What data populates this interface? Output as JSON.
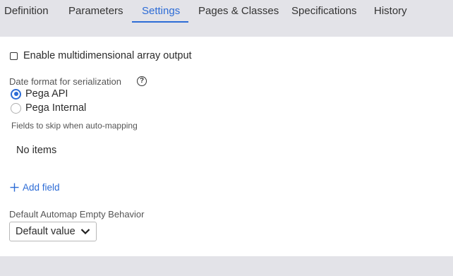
{
  "tabs": [
    {
      "label": "Definition",
      "active": false
    },
    {
      "label": "Parameters",
      "active": false
    },
    {
      "label": "Settings",
      "active": true
    },
    {
      "label": "Pages & Classes",
      "active": false
    },
    {
      "label": "Specifications",
      "active": false
    },
    {
      "label": "History",
      "active": false
    }
  ],
  "settings": {
    "multidim_checkbox": {
      "label": "Enable multidimensional array output",
      "checked": false
    },
    "date_format": {
      "label": "Date format for serialization",
      "help_icon": "question-circle-icon",
      "help_glyph": "?",
      "options": [
        {
          "label": "Pega API",
          "selected": true
        },
        {
          "label": "Pega Internal",
          "selected": false
        }
      ]
    },
    "skip_fields": {
      "label": "Fields to skip when auto-mapping",
      "empty_text": "No items",
      "add_label": "Add field"
    },
    "automap": {
      "label": "Default Automap Empty Behavior",
      "selected_value": "Default value"
    }
  },
  "colors": {
    "accent": "#2d6cd6",
    "tabbar_bg": "#e3e3e8",
    "panel_bg": "#ffffff"
  }
}
